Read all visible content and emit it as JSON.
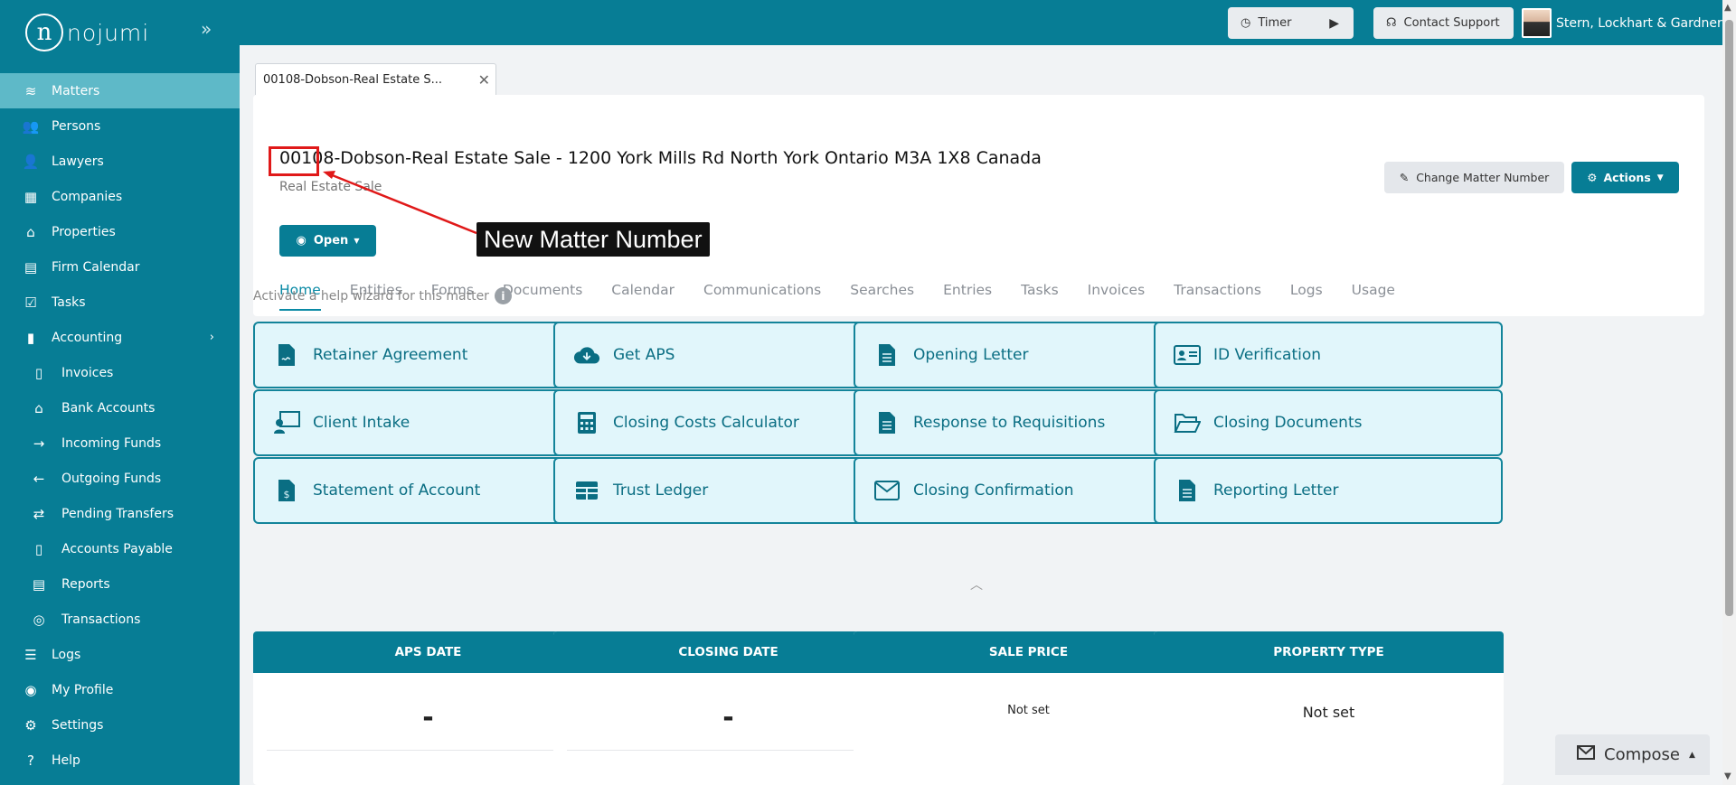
{
  "brand": {
    "logo_text": "nojumi",
    "logo_mark": "n"
  },
  "sidebar": {
    "items": [
      {
        "label": "Matters",
        "icon": "layers-icon",
        "glyph": "≋",
        "active": true,
        "sub": false
      },
      {
        "label": "Persons",
        "icon": "users-icon",
        "glyph": "👥",
        "sub": false
      },
      {
        "label": "Lawyers",
        "icon": "user-icon",
        "glyph": "👤",
        "sub": false
      },
      {
        "label": "Companies",
        "icon": "building-icon",
        "glyph": "▦",
        "sub": false
      },
      {
        "label": "Properties",
        "icon": "home-icon",
        "glyph": "⌂",
        "sub": false
      },
      {
        "label": "Firm Calendar",
        "icon": "calendar-icon",
        "glyph": "▤",
        "sub": false
      },
      {
        "label": "Tasks",
        "icon": "check-square-icon",
        "glyph": "☑",
        "sub": false
      },
      {
        "label": "Accounting",
        "icon": "book-icon",
        "glyph": "▮",
        "sub": false,
        "expand": true
      },
      {
        "label": "Invoices",
        "icon": "invoice-icon",
        "glyph": "▯",
        "sub": true
      },
      {
        "label": "Bank Accounts",
        "icon": "bank-icon",
        "glyph": "⌂",
        "sub": true
      },
      {
        "label": "Incoming Funds",
        "icon": "arrow-right-icon",
        "glyph": "→",
        "sub": true
      },
      {
        "label": "Outgoing Funds",
        "icon": "arrow-left-icon",
        "glyph": "←",
        "sub": true
      },
      {
        "label": "Pending Transfers",
        "icon": "transfer-icon",
        "glyph": "⇄",
        "sub": true
      },
      {
        "label": "Accounts Payable",
        "icon": "invoice-dollar-icon",
        "glyph": "▯",
        "sub": true
      },
      {
        "label": "Reports",
        "icon": "report-icon",
        "glyph": "▤",
        "sub": true
      },
      {
        "label": "Transactions",
        "icon": "coins-icon",
        "glyph": "◎",
        "sub": true
      },
      {
        "label": "Logs",
        "icon": "list-icon",
        "glyph": "☰",
        "sub": false
      },
      {
        "label": "My Profile",
        "icon": "user-circle-icon",
        "glyph": "◉",
        "sub": false
      },
      {
        "label": "Settings",
        "icon": "gear-icon",
        "glyph": "⚙",
        "sub": false
      },
      {
        "label": "Help",
        "icon": "question-circle-icon",
        "glyph": "?",
        "sub": false
      }
    ]
  },
  "topbar": {
    "timer_label": "Timer",
    "support_label": "Contact Support",
    "firm_name": "Stern, Lockhart & Gardner"
  },
  "doc_tab": {
    "label": "00108-Dobson-Real Estate S...",
    "close": "✕"
  },
  "matter": {
    "title": "00108-Dobson-Real Estate Sale - 1200 York Mills Rd North York Ontario M3A 1X8 Canada",
    "subtitle": "Real Estate Sale",
    "change_number_label": "Change Matter Number",
    "actions_label": "Actions",
    "status_label": "Open"
  },
  "annotation": {
    "label": "New Matter Number"
  },
  "tabs": [
    "Home",
    "Entities",
    "Forms",
    "Documents",
    "Calendar",
    "Communications",
    "Searches",
    "Entries",
    "Tasks",
    "Invoices",
    "Transactions",
    "Logs",
    "Usage"
  ],
  "help_wizard": {
    "text": "Activate a help wizard for this matter",
    "info": "i"
  },
  "wizards": [
    {
      "label": "Retainer Agreement",
      "icon": "file-signature-icon"
    },
    {
      "label": "Get APS",
      "icon": "cloud-download-icon"
    },
    {
      "label": "Opening Letter",
      "icon": "file-text-icon"
    },
    {
      "label": "ID Verification",
      "icon": "id-card-icon"
    },
    {
      "label": "Client Intake",
      "icon": "client-intake-icon"
    },
    {
      "label": "Closing Costs Calculator",
      "icon": "calculator-icon"
    },
    {
      "label": "Response to Requisitions",
      "icon": "file-text-icon"
    },
    {
      "label": "Closing Documents",
      "icon": "folder-open-icon"
    },
    {
      "label": "Statement of Account",
      "icon": "file-invoice-dollar-icon"
    },
    {
      "label": "Trust Ledger",
      "icon": "table-icon"
    },
    {
      "label": "Closing Confirmation",
      "icon": "envelope-icon"
    },
    {
      "label": "Reporting Letter",
      "icon": "file-text-icon"
    }
  ],
  "info_cards": [
    {
      "title": "APS DATE",
      "value": "-"
    },
    {
      "title": "CLOSING DATE",
      "value": "-"
    },
    {
      "title": "SALE PRICE",
      "value": "Not set"
    },
    {
      "title": "PROPERTY TYPE",
      "value": "Not set"
    }
  ],
  "compose": {
    "label": "Compose"
  },
  "colors": {
    "brand": "#077d95",
    "sidebar_active": "#5eb9c8",
    "wizard_bg": "#e1f6fb",
    "annotation": "#e01919"
  }
}
